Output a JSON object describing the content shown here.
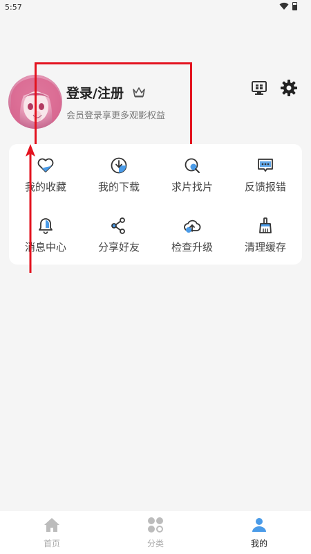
{
  "status_bar": {
    "time": "5:57"
  },
  "profile": {
    "title": "登录/注册",
    "subtitle": "会员登录享更多观影权益"
  },
  "menu": {
    "items": [
      {
        "label": "我的收藏",
        "icon": "heart-icon"
      },
      {
        "label": "我的下载",
        "icon": "download-icon"
      },
      {
        "label": "求片找片",
        "icon": "search-film-icon"
      },
      {
        "label": "反馈报错",
        "icon": "feedback-icon"
      },
      {
        "label": "消息中心",
        "icon": "bell-icon"
      },
      {
        "label": "分享好友",
        "icon": "share-icon"
      },
      {
        "label": "检查升级",
        "icon": "cloud-upload-icon"
      },
      {
        "label": "清理缓存",
        "icon": "broom-icon"
      }
    ]
  },
  "bottom_nav": {
    "items": [
      {
        "label": "首页",
        "icon": "home-icon",
        "active": false
      },
      {
        "label": "分类",
        "icon": "category-icon",
        "active": false
      },
      {
        "label": "我的",
        "icon": "user-icon",
        "active": true
      }
    ]
  },
  "colors": {
    "accent_blue": "#4a9be8",
    "annotation_red": "#e3131f",
    "background": "#f5f5f5"
  }
}
